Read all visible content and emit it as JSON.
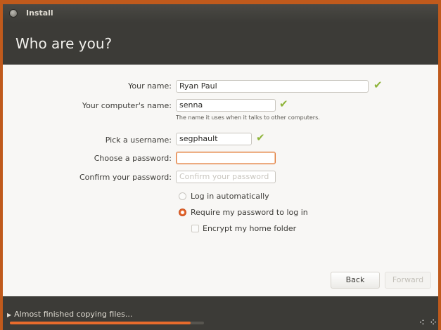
{
  "window": {
    "title": "Install"
  },
  "header": {
    "title": "Who are you?"
  },
  "form": {
    "name": {
      "label": "Your name:",
      "value": "Ryan Paul",
      "valid": true
    },
    "computer_name": {
      "label": "Your computer's name:",
      "value": "senna",
      "valid": true,
      "hint": "The name it uses when it talks to other computers."
    },
    "username": {
      "label": "Pick a username:",
      "value": "segphault",
      "valid": true
    },
    "password": {
      "label": "Choose a password:",
      "value": ""
    },
    "confirm_password": {
      "label": "Confirm your password:",
      "placeholder": "Confirm your password"
    },
    "login_options": [
      {
        "label": "Log in automatically",
        "selected": false
      },
      {
        "label": "Require my password to log in",
        "selected": true
      }
    ],
    "encrypt": {
      "label": "Encrypt my home folder",
      "checked": false
    }
  },
  "buttons": {
    "back": "Back",
    "forward": "Forward"
  },
  "footer": {
    "progress_text": "Almost finished copying files...",
    "progress_fraction": 0.93,
    "expander_icon": "triangle-right-icon"
  },
  "colors": {
    "accent": "#e86b2c",
    "valid_check": "#8fb43a",
    "header_bg": "#3c3b37"
  }
}
